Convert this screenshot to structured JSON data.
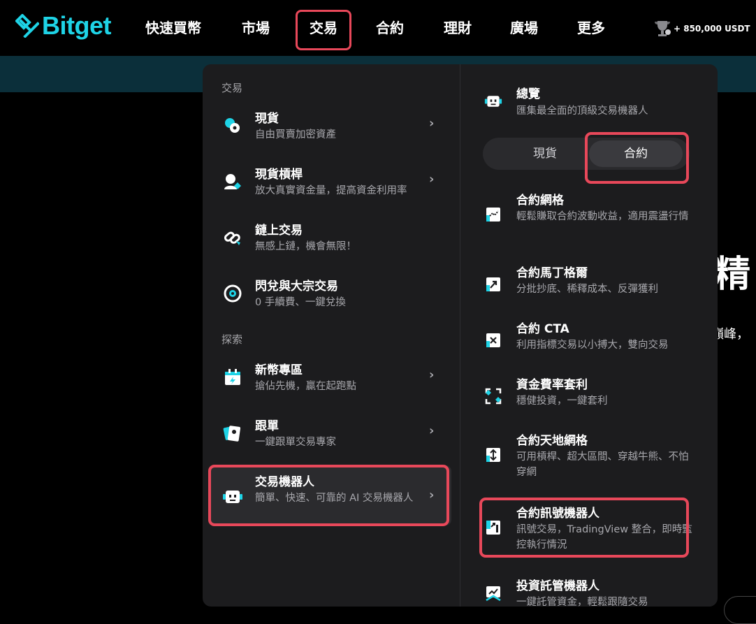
{
  "brand": {
    "name": "Bitget"
  },
  "nav": {
    "items": [
      "快速買幣",
      "市場",
      "交易",
      "合約",
      "理財",
      "廣場",
      "更多"
    ],
    "active": "交易",
    "prize": "+ 850,000 USDT"
  },
  "background": {
    "headline_fragment": "精",
    "sub_fragment": "巔峰，"
  },
  "left": {
    "section_trade": "交易",
    "section_explore": "探索",
    "items": [
      {
        "title": "現貨",
        "desc": "自由買賣加密資產",
        "chevron": true,
        "icon": "spot-coin-icon"
      },
      {
        "title": "現貨槓桿",
        "desc": "放大真實資金量，提高資金利用率",
        "chevron": true,
        "icon": "margin-icon"
      },
      {
        "title": "鏈上交易",
        "desc": "無感上鏈，機會無限！",
        "chevron": false,
        "icon": "link-chain-icon"
      },
      {
        "title": "閃兌與大宗交易",
        "desc": "0 手續費、一鍵兌換",
        "chevron": false,
        "icon": "swap-icon"
      },
      {
        "title": "新幣專區",
        "desc": "搶佔先機，贏在起跑點",
        "chevron": true,
        "icon": "calendar-icon"
      },
      {
        "title": "跟單",
        "desc": "一鍵跟單交易專家",
        "chevron": true,
        "icon": "copy-trade-icon"
      },
      {
        "title": "交易機器人",
        "desc": "簡單、快速、可靠的 AI 交易機器人",
        "chevron": true,
        "icon": "robot-icon"
      }
    ]
  },
  "right": {
    "overview": {
      "title": "總覽",
      "desc": "匯集最全面的頂級交易機器人"
    },
    "segment": {
      "spot": "現貨",
      "futures": "合約"
    },
    "items": [
      {
        "title": "合約網格",
        "desc": "輕鬆賺取合約波動收益，適用震盪行情",
        "icon": "futures-grid-icon"
      },
      {
        "title": "合約馬丁格爾",
        "desc": "分批抄底、稀釋成本、反彈獲利",
        "icon": "martingale-icon"
      },
      {
        "title": "合約 CTA",
        "desc": "利用指標交易以小搏大，雙向交易",
        "icon": "cta-icon"
      },
      {
        "title": "資金費率套利",
        "desc": "穩健投資，一鍵套利",
        "icon": "funding-arbitrage-icon"
      },
      {
        "title": "合約天地網格",
        "desc": "可用槓桿、超大區間、穿越牛熊、不怕穿網",
        "icon": "infinity-grid-icon"
      },
      {
        "title": "合約訊號機器人",
        "desc": "訊號交易，TradingView 整合，即時監控執行情況",
        "icon": "signal-bot-icon"
      },
      {
        "title": "投資託管機器人",
        "desc": "一鍵託管資金，輕鬆跟隨交易",
        "icon": "managed-bot-icon"
      }
    ]
  },
  "colors": {
    "accent": "#1ed3e6",
    "highlight": "#e8485a",
    "panel": "#1c1c1e"
  }
}
